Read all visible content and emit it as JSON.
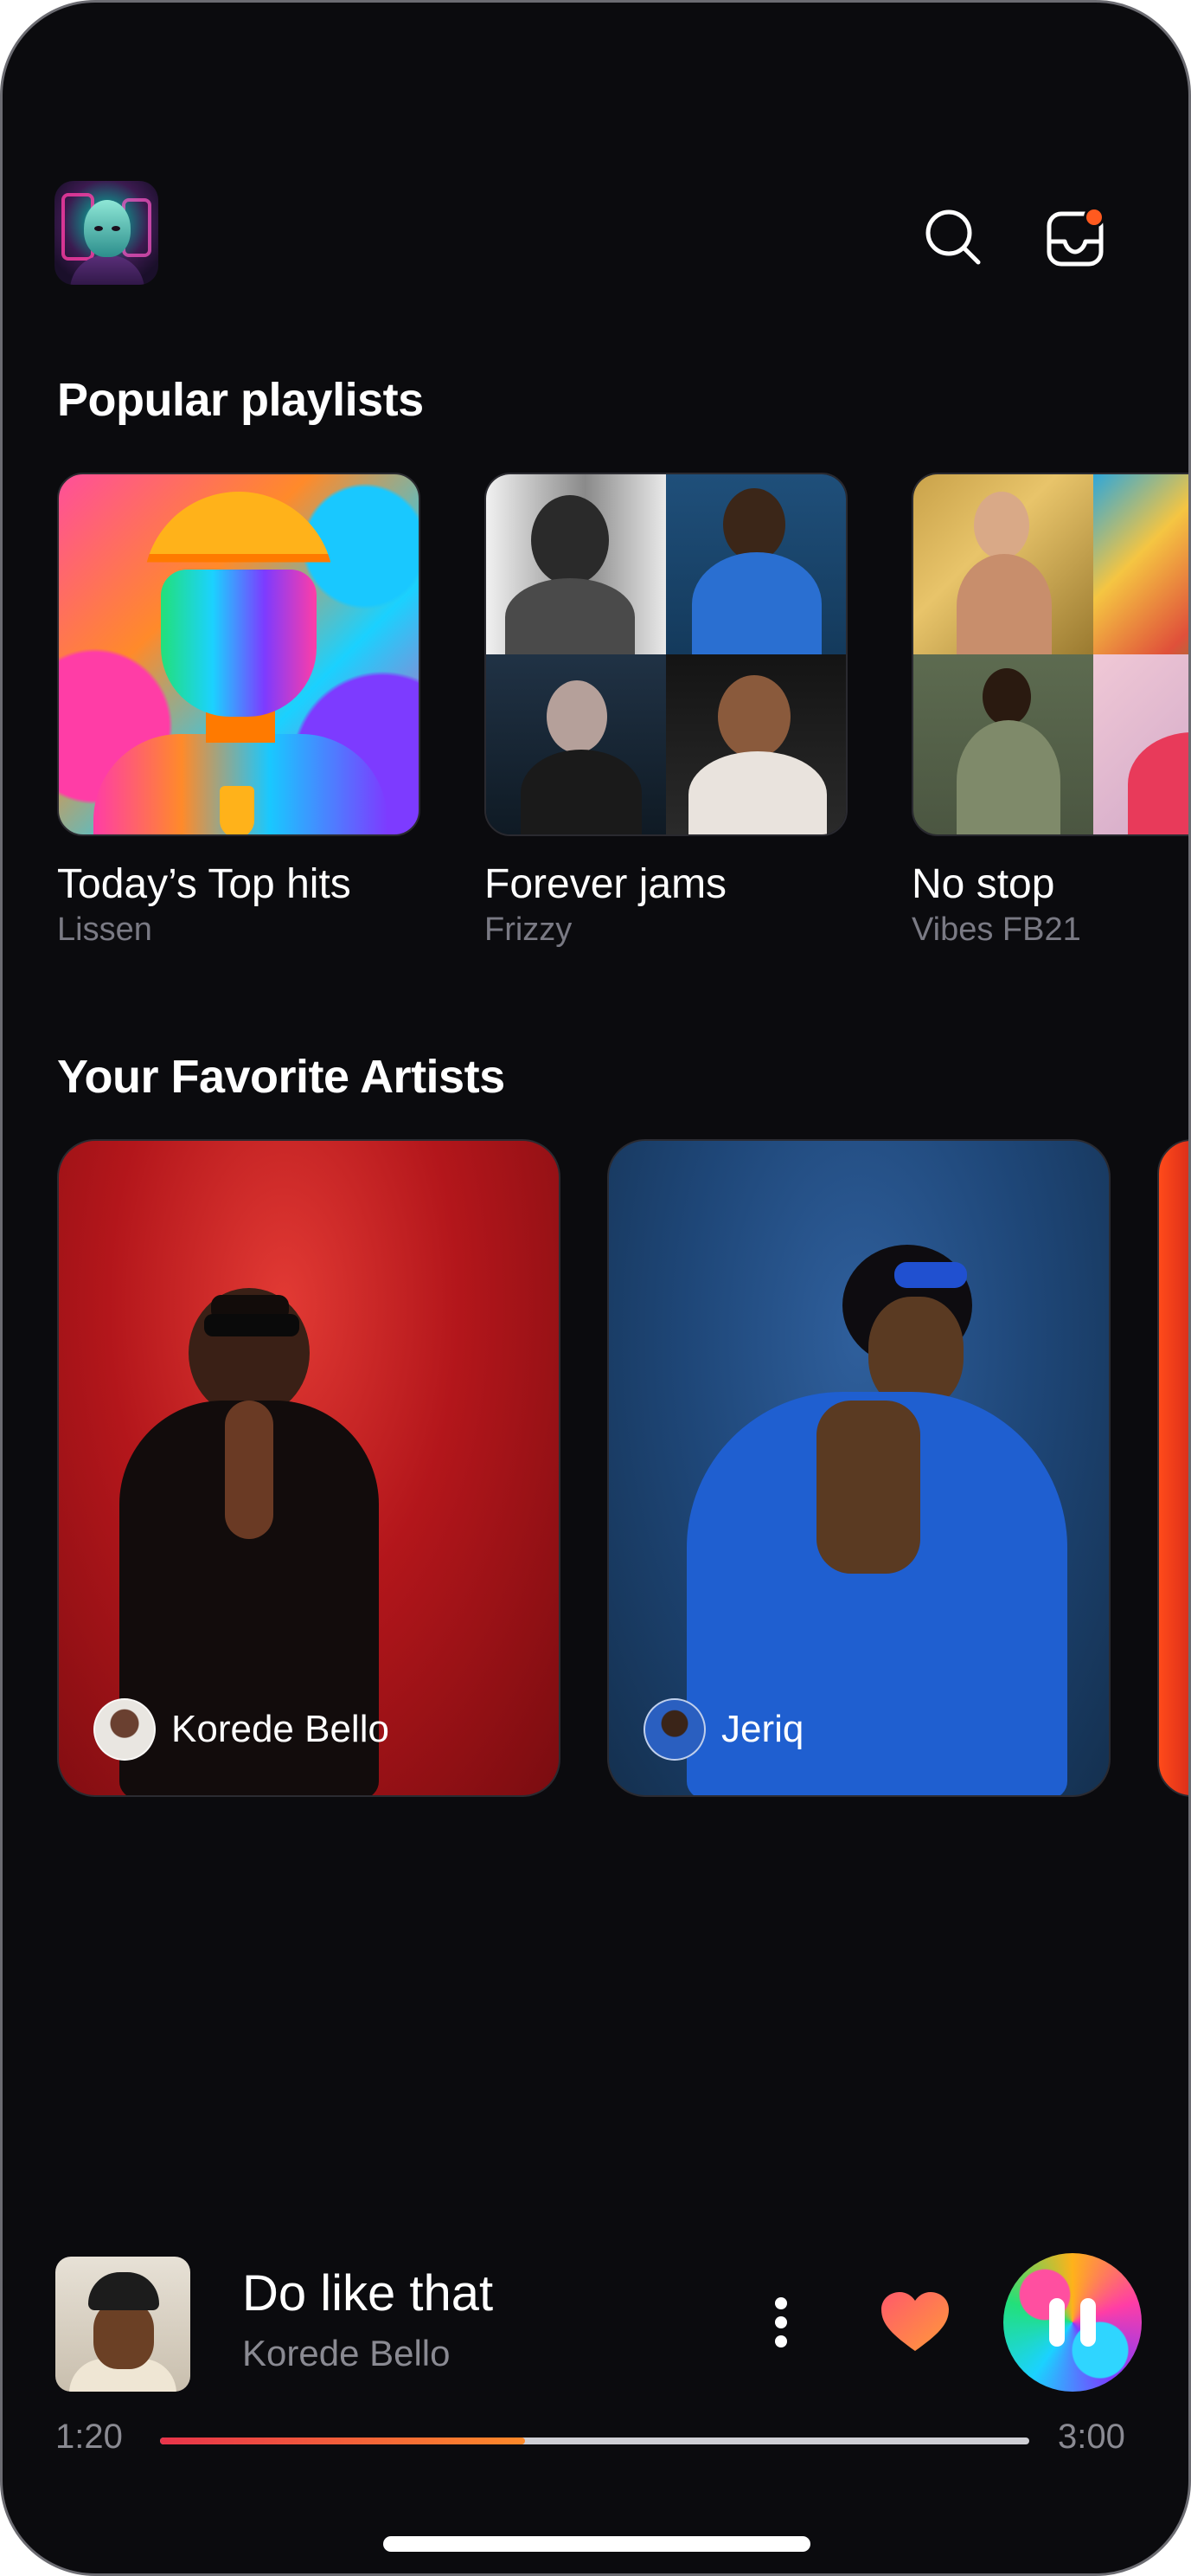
{
  "header": {
    "profile_avatar": "alien-character-avatar",
    "search_icon": "search-icon",
    "inbox_icon": "inbox-notification-icon",
    "notification_dot_color": "#ff5a1f"
  },
  "popular_playlists": {
    "title": "Popular playlists",
    "items": [
      {
        "name": "Today’s Top hits",
        "subtitle": "Lissen"
      },
      {
        "name": "Forever jams",
        "subtitle": "Frizzy"
      },
      {
        "name": "No stop",
        "subtitle": "Vibes FB21"
      }
    ]
  },
  "favorite_artists": {
    "title": "Your Favorite Artists",
    "items": [
      {
        "name": "Korede Bello",
        "bg_color": "#c41a20"
      },
      {
        "name": "Jeriq",
        "bg_color": "#23507f"
      }
    ]
  },
  "player": {
    "song_title": "Do like that",
    "artist": "Korede Bello",
    "elapsed": "1:20",
    "duration": "3:00",
    "progress": 0.42,
    "liked": true,
    "state": "playing",
    "accent_gradient": [
      "#e8344a",
      "#ff8a2a"
    ]
  },
  "colors": {
    "background": "#0b0b0e",
    "secondary_text": "#7a7a84"
  }
}
